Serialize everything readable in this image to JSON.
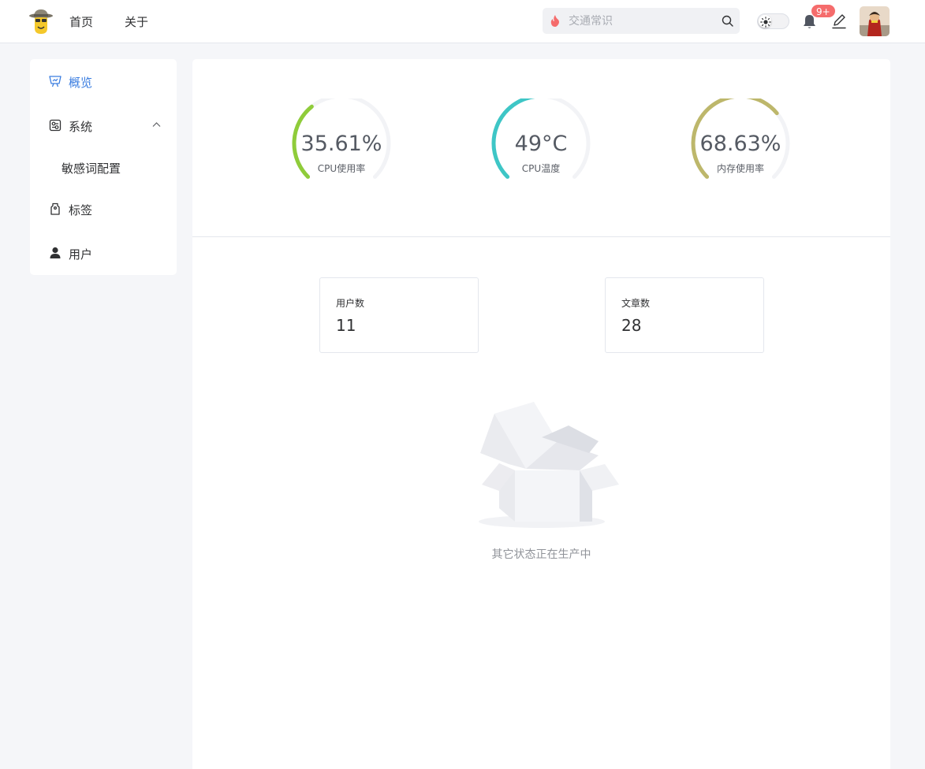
{
  "header": {
    "nav": {
      "home": "首页",
      "about": "关于"
    },
    "search": {
      "value": "",
      "placeholder": "交通常识"
    },
    "notifications": {
      "badge": "9+"
    },
    "colors": {
      "accent": "#3a7de0",
      "badge": "#f56c6c",
      "fire": "#f56c6c"
    }
  },
  "sidebar": {
    "items": [
      {
        "label": "概览",
        "icon": "presentation-board-icon",
        "active": true
      },
      {
        "label": "系统",
        "icon": "system-settings-icon",
        "expanded": true
      },
      {
        "label": "敏感词配置",
        "submenu": true
      },
      {
        "label": "标签",
        "icon": "tag-icon"
      },
      {
        "label": "用户",
        "icon": "user-icon"
      }
    ]
  },
  "gauges": [
    {
      "value_text": "35.61%",
      "label": "CPU使用率",
      "value": 0.3561,
      "color": "#8fcc3a"
    },
    {
      "value_text": "49°C",
      "label": "CPU温度",
      "value": 0.49,
      "color": "#3ec6c6"
    },
    {
      "value_text": "68.63%",
      "label": "内存使用率",
      "value": 0.6863,
      "color": "#bdb76b"
    }
  ],
  "stats": [
    {
      "title": "用户数",
      "value": "11"
    },
    {
      "title": "文章数",
      "value": "28"
    }
  ],
  "empty_state": {
    "text": "其它状态正在生产中",
    "icon": "empty-box-icon"
  }
}
